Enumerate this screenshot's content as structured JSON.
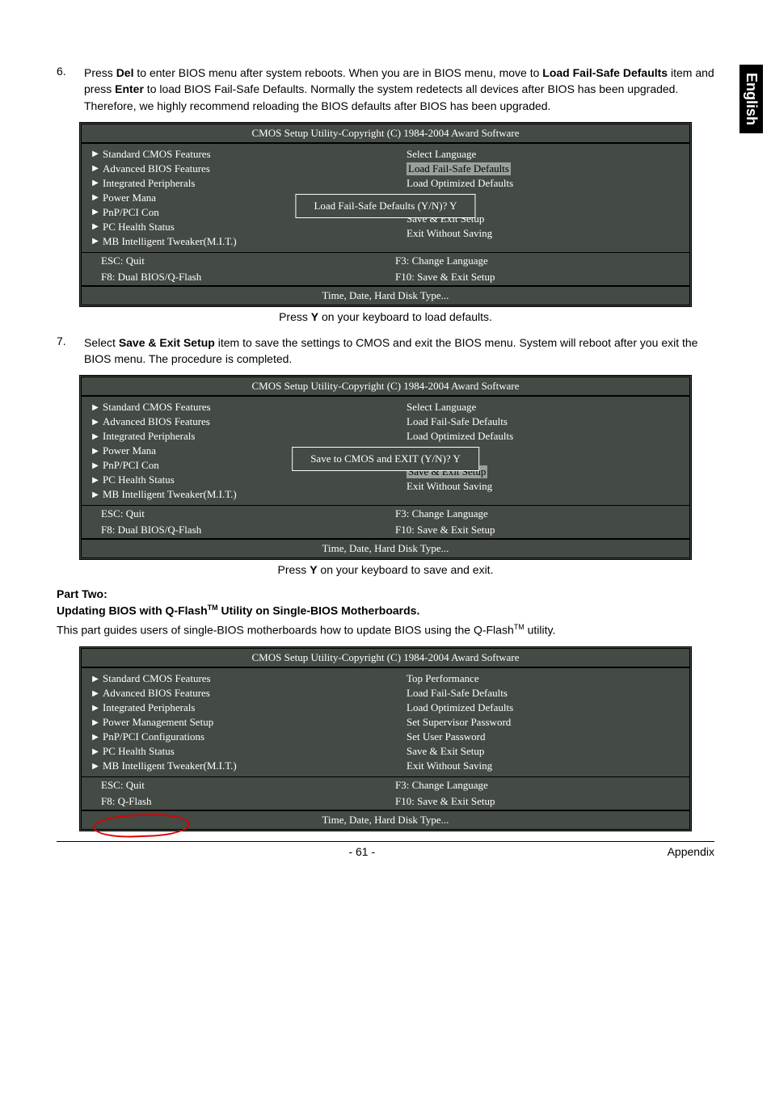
{
  "sideTab": "English",
  "step6": {
    "num": "6.",
    "text_parts": [
      "Press ",
      "Del",
      " to enter BIOS menu after system reboots. When you are in BIOS menu, move to ",
      "Load Fail-Safe Defaults",
      " item and press ",
      "Enter",
      " to load BIOS Fail-Safe Defaults. Normally the system redetects all devices after BIOS has been upgraded. Therefore, we highly recommend reloading the BIOS defaults after BIOS has been upgraded."
    ]
  },
  "bios1": {
    "title": "CMOS Setup Utility-Copyright (C) 1984-2004 Award Software",
    "left": [
      "Standard CMOS Features",
      "Advanced BIOS Features",
      "Integrated Peripherals",
      "Power Mana",
      "PnP/PCI Con",
      "PC Health Status",
      "MB Intelligent Tweaker(M.I.T.)"
    ],
    "right": [
      {
        "label": "Select Language",
        "hl": false
      },
      {
        "label": "Load Fail-Safe Defaults",
        "hl": true
      },
      {
        "label": "Load Optimized Defaults",
        "hl": false
      },
      {
        "label": "",
        "hl": false
      },
      {
        "label": "",
        "hl": false
      },
      {
        "label": "Save & Exit Setup",
        "hl": false
      },
      {
        "label": "Exit Without Saving",
        "hl": false
      }
    ],
    "popup": "Load Fail-Safe Defaults (Y/N)? Y",
    "footer": {
      "l1": "ESC: Quit",
      "r1": "F3: Change Language",
      "l2": "F8: Dual BIOS/Q-Flash",
      "r2": "F10: Save & Exit Setup"
    },
    "help": "Time, Date, Hard Disk Type..."
  },
  "caption1_parts": [
    "Press ",
    "Y",
    " on your keyboard to load defaults."
  ],
  "step7": {
    "num": "7.",
    "text_parts": [
      "Select ",
      "Save & Exit Setup",
      " item to save the settings to CMOS and exit the BIOS menu. System will reboot after you exit the BIOS menu. The procedure is completed."
    ]
  },
  "bios2": {
    "title": "CMOS Setup Utility-Copyright (C) 1984-2004 Award Software",
    "left": [
      "Standard CMOS Features",
      "Advanced BIOS Features",
      "Integrated Peripherals",
      "Power Mana",
      "PnP/PCI Con",
      "PC Health Status",
      "MB Intelligent Tweaker(M.I.T.)"
    ],
    "right": [
      {
        "label": "Select Language",
        "hl": false
      },
      {
        "label": "Load Fail-Safe Defaults",
        "hl": false
      },
      {
        "label": "Load Optimized Defaults",
        "hl": false
      },
      {
        "label": "",
        "hl": false
      },
      {
        "label": "",
        "hl": false
      },
      {
        "label": "Save & Exit Setup",
        "hl": true
      },
      {
        "label": "Exit Without Saving",
        "hl": false
      }
    ],
    "popup": "Save to CMOS and EXIT (Y/N)? Y",
    "footer": {
      "l1": "ESC: Quit",
      "r1": "F3: Change Language",
      "l2": "F8: Dual BIOS/Q-Flash",
      "r2": "F10: Save & Exit Setup"
    },
    "help": "Time, Date, Hard Disk Type..."
  },
  "caption2_parts": [
    "Press ",
    "Y",
    " on your keyboard to save and exit."
  ],
  "partTwo": {
    "head": "Part Two:",
    "sub_parts": [
      "Updating BIOS with Q-Flash",
      "TM",
      " Utility on Single-BIOS Motherboards."
    ],
    "p_parts": [
      "This part guides users of single-BIOS motherboards how to update BIOS using the Q-Flash",
      "TM",
      " utility."
    ]
  },
  "bios3": {
    "title": "CMOS Setup Utility-Copyright (C) 1984-2004 Award Software",
    "left": [
      "Standard CMOS Features",
      "Advanced BIOS Features",
      "Integrated Peripherals",
      "Power Management Setup",
      "PnP/PCI Configurations",
      "PC Health Status",
      "MB Intelligent Tweaker(M.I.T.)"
    ],
    "right": [
      "Top Performance",
      "Load Fail-Safe Defaults",
      "Load Optimized Defaults",
      "Set Supervisor Password",
      "Set User Password",
      "Save & Exit Setup",
      "Exit Without Saving"
    ],
    "footer": {
      "l1": "ESC: Quit",
      "r1": "F3: Change Language",
      "l2": "F8: Q-Flash",
      "r2": "F10: Save & Exit Setup"
    },
    "help": "Time, Date, Hard Disk Type..."
  },
  "pageFooter": {
    "center": "- 61 -",
    "right": "Appendix"
  }
}
